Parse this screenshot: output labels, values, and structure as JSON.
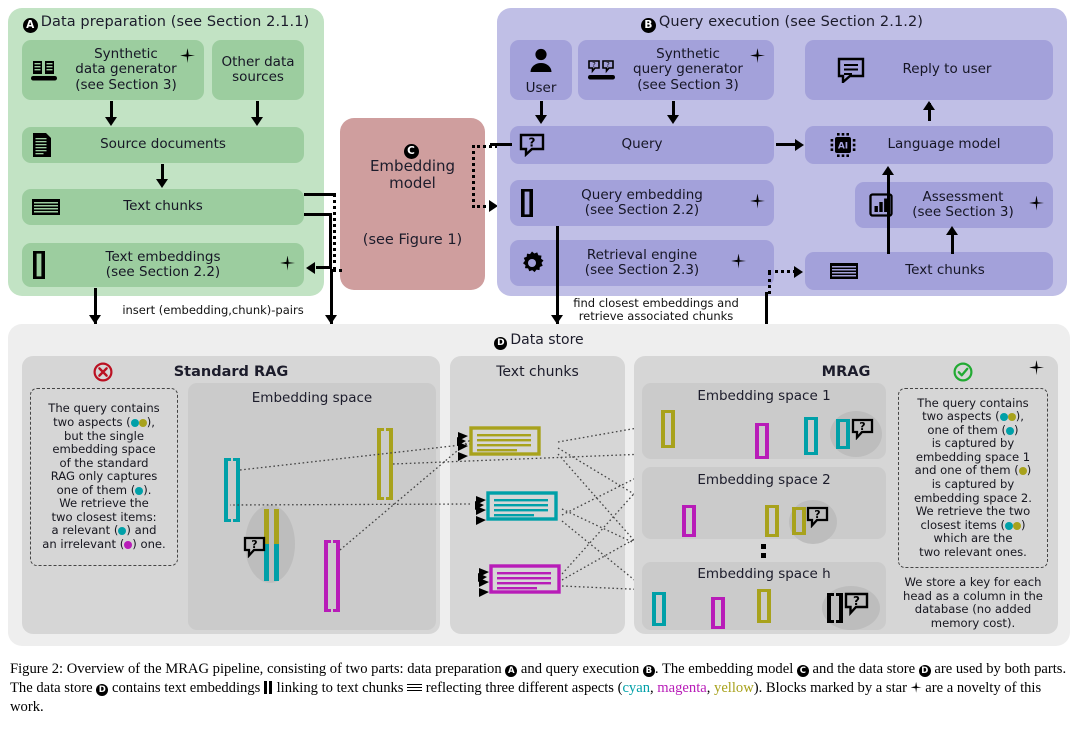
{
  "figure": {
    "panels": {
      "A": {
        "badge": "A",
        "title": "Data preparation (see Section 2.1.1)"
      },
      "B": {
        "badge": "B",
        "title": "Query execution (see Section 2.1.2)"
      },
      "C": {
        "badge": "C",
        "title": "Embedding\nmodel",
        "subtitle": "(see Figure 1)"
      },
      "D": {
        "badge": "D",
        "title": "Data store"
      }
    },
    "data_preparation": {
      "nodes": [
        {
          "id": "synthetic-data-generator",
          "label": "Synthetic\ndata generator\n(see Section 3)",
          "icon": "factory-icon",
          "star": true
        },
        {
          "id": "other-data-sources",
          "label": "Other data\nsources",
          "icon": "none",
          "star": false
        },
        {
          "id": "source-documents",
          "label": "Source documents",
          "icon": "document-icon",
          "star": false
        },
        {
          "id": "text-chunks",
          "label": "Text chunks",
          "icon": "chunks-icon",
          "star": false
        },
        {
          "id": "text-embeddings",
          "label": "Text embeddings\n(see Section 2.2)",
          "icon": "embedding-icon",
          "star": true
        }
      ]
    },
    "query_execution": {
      "nodes": [
        {
          "id": "user",
          "label": "User",
          "icon": "user-icon",
          "star": false
        },
        {
          "id": "synthetic-query-generator",
          "label": "Synthetic\nquery generator\n(see Section 3)",
          "icon": "query-factory-icon",
          "star": true
        },
        {
          "id": "reply-to-user",
          "label": "Reply to user",
          "icon": "reply-icon",
          "star": false
        },
        {
          "id": "query",
          "label": "Query",
          "icon": "question-bubble-icon",
          "star": false
        },
        {
          "id": "language-model",
          "label": "Language model",
          "icon": "ai-chip-icon",
          "star": false
        },
        {
          "id": "query-embedding",
          "label": "Query embedding\n(see Section 2.2)",
          "icon": "embedding-icon",
          "star": true
        },
        {
          "id": "assessment",
          "label": "Assessment\n(see Section 3)",
          "icon": "bar-chart-icon",
          "star": true
        },
        {
          "id": "retrieval-engine",
          "label": "Retrieval engine\n(see Section 2.3)",
          "icon": "gear-icon",
          "star": true
        },
        {
          "id": "text-chunks-b",
          "label": "Text chunks",
          "icon": "chunks-icon",
          "star": false
        }
      ]
    },
    "edge_labels": {
      "insert": "insert (embedding,chunk)-pairs",
      "retrieve": "find closest embeddings and\nretrieve associated chunks"
    },
    "data_store": {
      "standard_rag": {
        "title": "Standard RAG",
        "status_icon": "cross-circle-icon",
        "embedding_space_label": "Embedding space",
        "note": "The query contains two aspects (●●), but the single embedding space of the standard RAG only captures one of them (●). We retrieve the two closest items: a relevant (●) and an irrelevant (●) one."
      },
      "text_chunks": {
        "title": "Text chunks",
        "items": [
          "yellow-chunk",
          "cyan-chunk",
          "magenta-chunk"
        ]
      },
      "mrag": {
        "title": "MRAG",
        "status_icon": "check-circle-icon",
        "star": true,
        "spaces": [
          "Embedding space 1",
          "Embedding space 2",
          "Embedding space h"
        ],
        "note": "The query contains two aspects (●●), one of them (●) is captured by embedding space 1 and one of them (●) is captured by embedding space 2. We retrieve the two closest items (●●) which are the two relevant ones.",
        "footnote": "We store a key for each head as a column in the database (no added memory cost)."
      }
    },
    "colors": {
      "cyan": "#00a0a8",
      "magenta": "#b81cb8",
      "yellow": "#a8a21c",
      "panel_a": "#c2e3c4",
      "panel_b": "#c0bfe6",
      "panel_c": "#cf9e9e",
      "panel_d": "#eeeeee",
      "node_a": "#9ccd9f",
      "node_b": "#a3a1da",
      "ok_green": "#22aa33",
      "error_red": "#bb1122"
    }
  },
  "caption": {
    "p1_a": "Figure 2: Overview of the MRAG pipeline, consisting of two parts: data preparation ",
    "p1_b": " and query execution ",
    "p1_c": ". The embedding model ",
    "p1_d": " and the data store ",
    "p1_e": " are used by both parts. The data store ",
    "p1_f": " contains text embeddings ",
    "p1_g": " linking to text chunks ",
    "p1_h": " reflecting three different aspects (",
    "cyan_word": "cyan",
    "magenta_word": "magenta",
    "yellow_word": "yellow",
    "p1_i": "). Blocks marked by a star ",
    "p1_j": " are a novelty of this work.",
    "sep1": ", ",
    "sep2": ", ",
    "badges": {
      "a": "A",
      "b": "B",
      "c": "C",
      "d": "D",
      "d2": "D"
    }
  }
}
